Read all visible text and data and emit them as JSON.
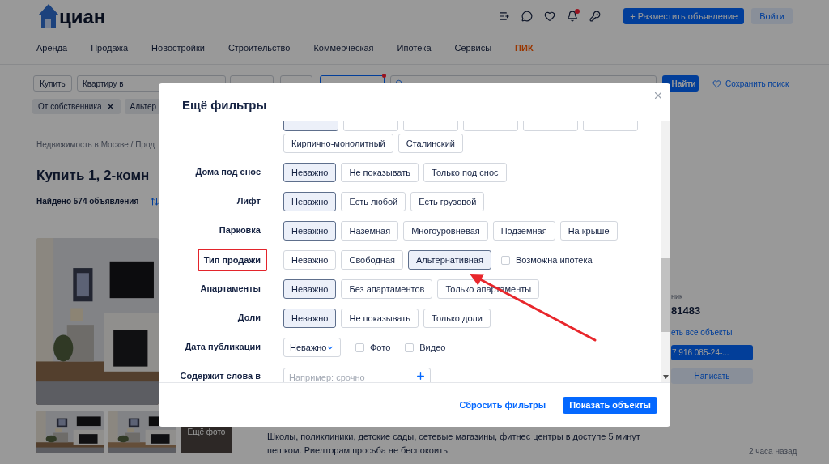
{
  "header": {
    "logo": "циан",
    "notifications_dot": true,
    "post_button": "+ Разместить объявление",
    "login_button": "Войти"
  },
  "nav": [
    {
      "label": "Аренда",
      "kind": "plain"
    },
    {
      "label": "Продажа",
      "kind": "plain"
    },
    {
      "label": "Новостройки",
      "kind": "plain"
    },
    {
      "label": "Строительство",
      "kind": "plain"
    },
    {
      "label": "Коммерческая",
      "kind": "plain"
    },
    {
      "label": "Ипотека",
      "kind": "plain"
    },
    {
      "label": "Сервисы",
      "kind": "plain"
    },
    {
      "label": "ПИК",
      "kind": "brand"
    }
  ],
  "search_bar": {
    "deal": "Купить",
    "type": "Квартиру в",
    "more_active": true,
    "find": "Найти",
    "save": "Сохранить поиск"
  },
  "chips": [
    {
      "label": "От собственника",
      "removable": true
    },
    {
      "label": "Альтер",
      "removable": false
    }
  ],
  "breadcrumb": "Недвижимость в Москве / Прод",
  "title": "Купить 1, 2-комн",
  "found": "Найдено 574 объявления",
  "listing": {
    "more_photos": "Ещё фото",
    "description": "Школы, поликлиники, детские сады, сетевые магазины, фитнес центры в доступе 5 минут пешком. Риелторам просьба не беспокоить.",
    "seller_role": "ник",
    "seller_id": "81483",
    "all_objects": "еть все объекты",
    "phone": "7 916 085-24-...",
    "write": "Написать",
    "time": "2 часа назад"
  },
  "filters_modal": {
    "title": "Ещё фильтры",
    "rows": [
      {
        "kind": "options",
        "options": [
          {
            "selected": true
          },
          {
            "selected": false
          },
          {
            "selected": false
          },
          {
            "selected": false
          },
          {
            "selected": false
          },
          {
            "selected": false
          },
          {
            "label": "Кирпично-монолитный",
            "selected": false
          },
          {
            "label": "Сталинский",
            "selected": false
          }
        ]
      },
      {
        "kind": "options",
        "label": "Дома под снос",
        "options": [
          {
            "label": "Неважно",
            "selected": true
          },
          {
            "label": "Не показывать",
            "selected": false
          },
          {
            "label": "Только под снос",
            "selected": false
          }
        ]
      },
      {
        "kind": "options",
        "label": "Лифт",
        "options": [
          {
            "label": "Неважно",
            "selected": true
          },
          {
            "label": "Есть любой",
            "selected": false
          },
          {
            "label": "Есть грузовой",
            "selected": false
          }
        ]
      },
      {
        "kind": "options",
        "label": "Парковка",
        "options": [
          {
            "label": "Неважно",
            "selected": true
          },
          {
            "label": "Наземная",
            "selected": false
          },
          {
            "label": "Многоуровневая",
            "selected": false
          },
          {
            "label": "Подземная",
            "selected": false
          },
          {
            "label": "На крыше",
            "selected": false
          }
        ]
      },
      {
        "kind": "options",
        "label": "Тип продажи",
        "annotated": true,
        "options": [
          {
            "label": "Неважно",
            "selected": false
          },
          {
            "label": "Свободная",
            "selected": false
          },
          {
            "label": "Альтернативная",
            "selected": true
          }
        ],
        "checkboxes": [
          {
            "label": "Возможна ипотека",
            "checked": false
          }
        ]
      },
      {
        "kind": "options",
        "label": "Апартаменты",
        "options": [
          {
            "label": "Неважно",
            "selected": true
          },
          {
            "label": "Без апартаментов",
            "selected": false
          },
          {
            "label": "Только апартаменты",
            "selected": false
          }
        ]
      },
      {
        "kind": "options",
        "label": "Доли",
        "options": [
          {
            "label": "Неважно",
            "selected": true
          },
          {
            "label": "Не показывать",
            "selected": false
          },
          {
            "label": "Только доли",
            "selected": false
          }
        ]
      },
      {
        "kind": "select",
        "label": "Дата публикации",
        "value": "Неважно",
        "checkboxes": [
          {
            "label": "Фото",
            "checked": false
          },
          {
            "label": "Видео",
            "checked": false
          }
        ]
      },
      {
        "kind": "text",
        "label": "Содержит слова в",
        "placeholder": "Например: срочно"
      }
    ],
    "reset": "Сбросить фильтры",
    "submit": "Показать объекты"
  }
}
